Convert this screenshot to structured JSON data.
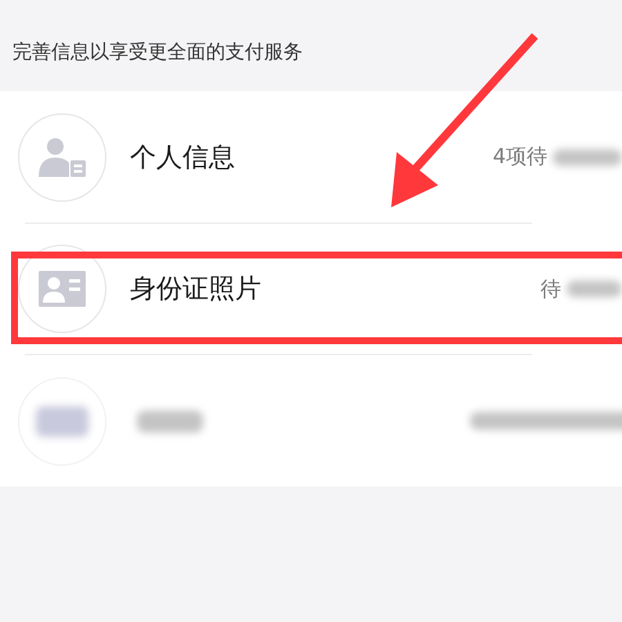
{
  "header": {
    "text": "完善信息以享受更全面的支付服务"
  },
  "rows": [
    {
      "kind": "person",
      "title": "个人信息",
      "status": "4项待",
      "blurred_tail": true,
      "highlighted": false
    },
    {
      "kind": "idcard",
      "title": "身份证照片",
      "status": "待",
      "blurred_tail": true,
      "highlighted": true
    },
    {
      "kind": "blurred",
      "highlighted": false
    }
  ]
}
